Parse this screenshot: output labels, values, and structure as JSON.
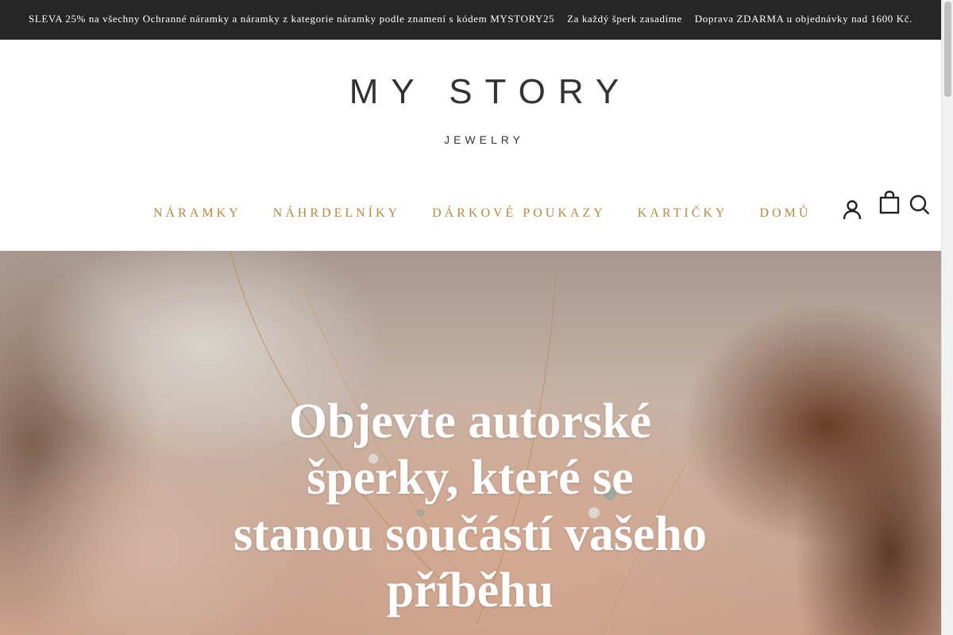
{
  "announcement": {
    "items": [
      "SLEVA 25% na všechny Ochranné náramky a náramky z kategorie náramky podle znamení s kódem MYSTORY25",
      "Za každý šperk zasadíme",
      "Doprava ZDARMA u objednávky nad 1600 Kč."
    ]
  },
  "logo": {
    "main": "MY STORY",
    "sub": "JEWELRY"
  },
  "nav": {
    "items": [
      {
        "label": "NÁRAMKY"
      },
      {
        "label": "NÁHRDELNÍKY"
      },
      {
        "label": "DÁRKOVÉ POUKAZY"
      },
      {
        "label": "KARTIČKY"
      },
      {
        "label": "DOMŮ"
      }
    ]
  },
  "header_icons": [
    "account-icon",
    "cart-icon",
    "search-icon"
  ],
  "hero": {
    "title": "Objevte autorské šperky, které se stanou součástí vašeho příběhu"
  },
  "colors": {
    "announcement_bg": "#262626",
    "nav_accent": "#b58a3a",
    "logo": "#333333"
  }
}
